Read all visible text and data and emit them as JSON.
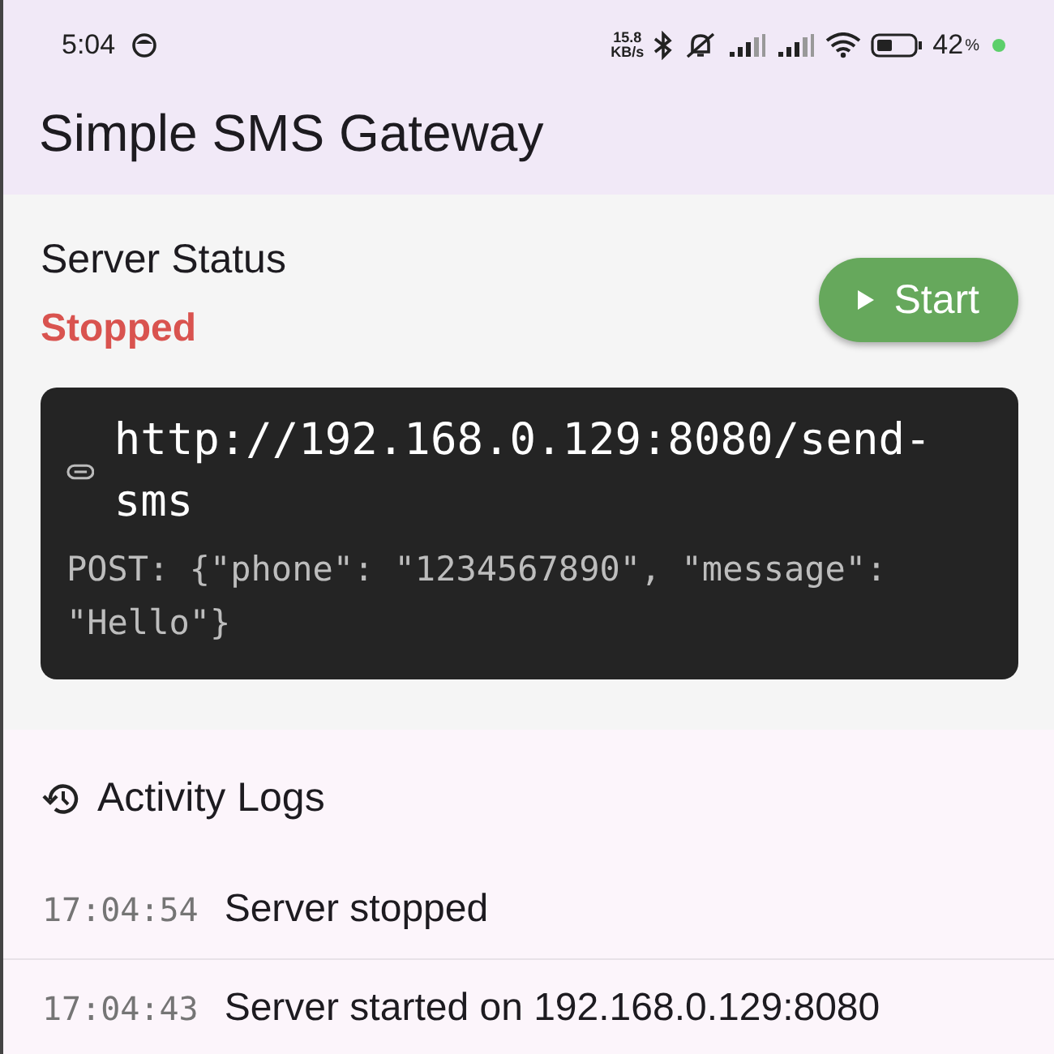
{
  "status_bar": {
    "time": "5:04",
    "net_speed": "15.8",
    "net_unit": "KB/s",
    "battery": "42",
    "battery_unit": "%"
  },
  "app_bar": {
    "title": "Simple SMS Gateway"
  },
  "server": {
    "heading": "Server Status",
    "status": "Stopped",
    "running": false,
    "button": "Start",
    "url": "http://192.168.0.129:8080/send-sms",
    "example": "POST: {\"phone\": \"1234567890\", \"message\": \"Hello\"}"
  },
  "logs": {
    "heading": "Activity Logs",
    "entries": [
      {
        "time": "17:04:54",
        "message": "Server stopped"
      },
      {
        "time": "17:04:43",
        "message": "Server started on 192.168.0.129:8080"
      }
    ]
  }
}
